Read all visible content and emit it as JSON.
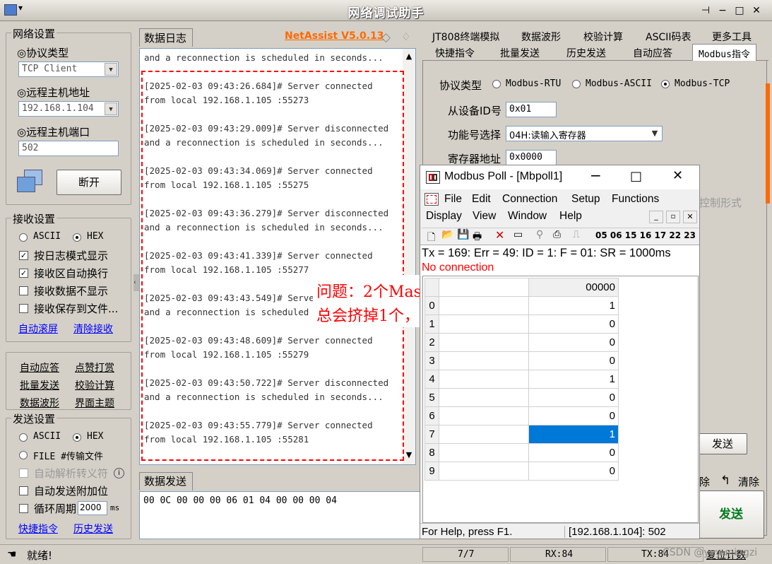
{
  "window": {
    "title": "网络调试助手"
  },
  "left": {
    "net_settings": {
      "title": "网络设置",
      "protocol_label": "◎协议类型",
      "protocol_value": "TCP Client",
      "host_label": "◎远程主机地址",
      "host_value": "192.168.1.104",
      "port_label": "◎远程主机端口",
      "port_value": "502",
      "disconnect_button": "断开"
    },
    "recv_settings": {
      "title": "接收设置",
      "ascii": "ASCII",
      "hex": "HEX",
      "options": [
        "按日志模式显示",
        "接收区自动换行",
        "接收数据不显示",
        "接收保存到文件..."
      ],
      "auto_scroll": "自动滚屏",
      "clear_recv": "清除接收"
    },
    "tools": {
      "items": [
        "自动应答",
        "点赞打赏",
        "批量发送",
        "校验计算",
        "数据波形",
        "界面主题"
      ]
    },
    "send_settings": {
      "title": "发送设置",
      "ascii": "ASCII",
      "hex": "HEX",
      "file": "FILE #传输文件",
      "options": [
        "自动解析转义符",
        "自动发送附加位",
        "循环周期"
      ],
      "period_value": "2000",
      "period_unit": "ms",
      "quick_cmd": "快捷指令",
      "history": "历史发送"
    }
  },
  "log": {
    "title": "数据日志",
    "brand": "NetAssist V5.0.13",
    "lines": [
      "and a reconnection is scheduled in seconds...",
      "",
      "[2025-02-03 09:43:26.684]# Server connected",
      "from local 192.168.1.105 :55273",
      "",
      "[2025-02-03 09:43:29.009]# Server disconnected",
      "and a reconnection is scheduled in seconds...",
      "",
      "[2025-02-03 09:43:34.069]# Server connected",
      "from local 192.168.1.105 :55275",
      "",
      "[2025-02-03 09:43:36.279]# Server disconnected",
      "and a reconnection is scheduled in seconds...",
      "",
      "[2025-02-03 09:43:41.339]# Server connected",
      "from local 192.168.1.105 :55277",
      "",
      "[2025-02-03 09:43:43.549]# Serve",
      "and a reconnection is scheduled",
      "",
      "[2025-02-03 09:43:48.609]# Server connected",
      "from local 192.168.1.105 :55279",
      "",
      "[2025-02-03 09:43:50.722]# Server disconnected",
      "and a reconnection is scheduled in seconds...",
      "",
      "[2025-02-03 09:43:55.779]# Server connected",
      "from local 192.168.1.105 :55281"
    ],
    "annotation_line1": "问题：2个Master TCP连接",
    "annotation_line2": "总会挤掉1个，如何处理？"
  },
  "send": {
    "title": "数据发送",
    "content": "00 0C 00 00 00 06 01 04 00 00 00 04"
  },
  "right": {
    "tabs_row1": [
      "JT808终端模拟",
      "数据波形",
      "校验计算",
      "ASCII码表",
      "更多工具"
    ],
    "tabs_row2": [
      "快捷指令",
      "批量发送",
      "历史发送",
      "自动应答",
      "Modbus指令"
    ],
    "protocol_label": "协议类型",
    "protocols": [
      "Modbus-RTU",
      "Modbus-ASCII",
      "Modbus-TCP"
    ],
    "slave_label": "从设备ID号",
    "slave_value": "0x01",
    "func_label": "功能号选择",
    "func_value": "04H:读输入寄存器",
    "reg_label": "寄存器地址",
    "reg_value": "0x0000",
    "partial_label": "控制形式",
    "send_button": "发送",
    "remove_label": "除",
    "clear_label": "清除",
    "send_big": "发送"
  },
  "modbus_poll": {
    "title": "Modbus Poll - [Mbpoll1]",
    "menu1": [
      "File",
      "Edit",
      "Connection",
      "Setup",
      "Functions"
    ],
    "menu2": [
      "Display",
      "View",
      "Window",
      "Help"
    ],
    "toolbar_codes": "05 06 15 16 17 22 23",
    "stats": "Tx = 169: Err = 49: ID = 1: F = 01: SR = 1000ms",
    "error": "No connection",
    "header_value": "00000",
    "rows": [
      {
        "n": "0",
        "v": "1"
      },
      {
        "n": "1",
        "v": "0"
      },
      {
        "n": "2",
        "v": "0"
      },
      {
        "n": "3",
        "v": "0"
      },
      {
        "n": "4",
        "v": "1"
      },
      {
        "n": "5",
        "v": "0"
      },
      {
        "n": "6",
        "v": "0"
      },
      {
        "n": "7",
        "v": "1"
      },
      {
        "n": "8",
        "v": "0"
      },
      {
        "n": "9",
        "v": "0"
      }
    ],
    "selected_row": 7,
    "status_help": "For Help, press F1.",
    "status_conn": "[192.168.1.104]: 502"
  },
  "status": {
    "ready": "就绪!",
    "count": "7/7",
    "rx": "RX:84",
    "tx": "TX:84",
    "reset": "复位计数",
    "watermark": "CSDN @yeyuningzi"
  },
  "colors": {
    "brand": "#ff6a00",
    "annotation": "#ff0000",
    "selected": "#0078d7",
    "dashed": "#ff0000",
    "send_green": "#007a1e"
  }
}
